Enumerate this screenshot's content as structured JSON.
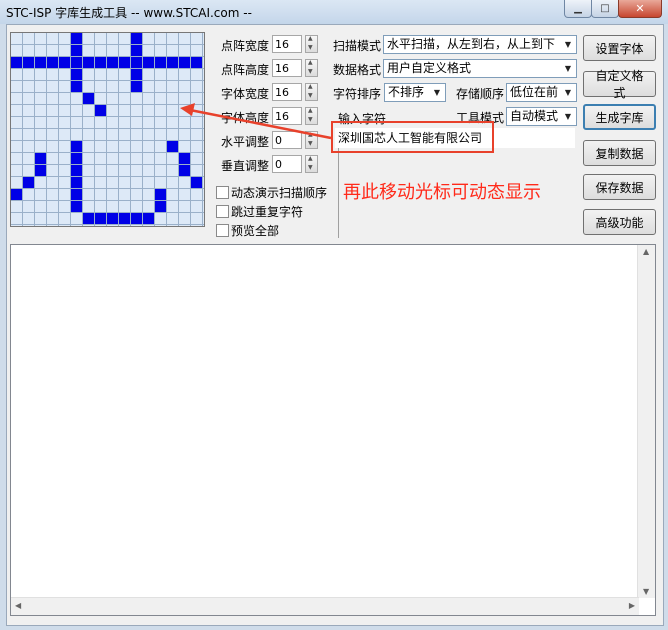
{
  "window": {
    "title": "STC-ISP 字库生成工具 -- www.STCAI.com --"
  },
  "preview": {
    "char": "心"
  },
  "params": [
    {
      "label": "点阵宽度",
      "value": "16"
    },
    {
      "label": "点阵高度",
      "value": "16"
    },
    {
      "label": "字体宽度",
      "value": "16"
    },
    {
      "label": "字体高度",
      "value": "16"
    },
    {
      "label": "水平调整",
      "value": "0"
    },
    {
      "label": "垂直调整",
      "value": "0"
    }
  ],
  "checkboxes": [
    {
      "label": "动态演示扫描顺序",
      "checked": false
    },
    {
      "label": "跳过重复字符",
      "checked": false
    },
    {
      "label": "预览全部",
      "checked": false
    }
  ],
  "options": {
    "scan_mode": {
      "label": "扫描模式",
      "value": "水平扫描，从左到右，从上到下"
    },
    "data_format": {
      "label": "数据格式",
      "value": "用户自定义格式"
    },
    "char_sort": {
      "label": "字符排序",
      "value": "不排序"
    },
    "store_order": {
      "label": "存储顺序",
      "value": "低位在前"
    },
    "work_mode": {
      "label": "工具模式",
      "value": "自动模式"
    }
  },
  "input": {
    "label": "输入字符",
    "value": "深圳国芯人工智能有限公司"
  },
  "buttons": [
    {
      "id": "set-font",
      "label": "设置字体"
    },
    {
      "id": "custom-format",
      "label": "自定义格式"
    },
    {
      "id": "generate",
      "label": "生成字库"
    },
    {
      "id": "copy",
      "label": "复制数据"
    },
    {
      "id": "save",
      "label": "保存数据"
    },
    {
      "id": "advanced",
      "label": "高级功能"
    }
  ],
  "annotation": {
    "text": "再此移动光标可动态显示",
    "color": "#ff2a1a"
  },
  "colors": {
    "pixel_on": "#0000e6",
    "grid_bg": "#dde9f7",
    "accent": "#3c7fb1"
  }
}
